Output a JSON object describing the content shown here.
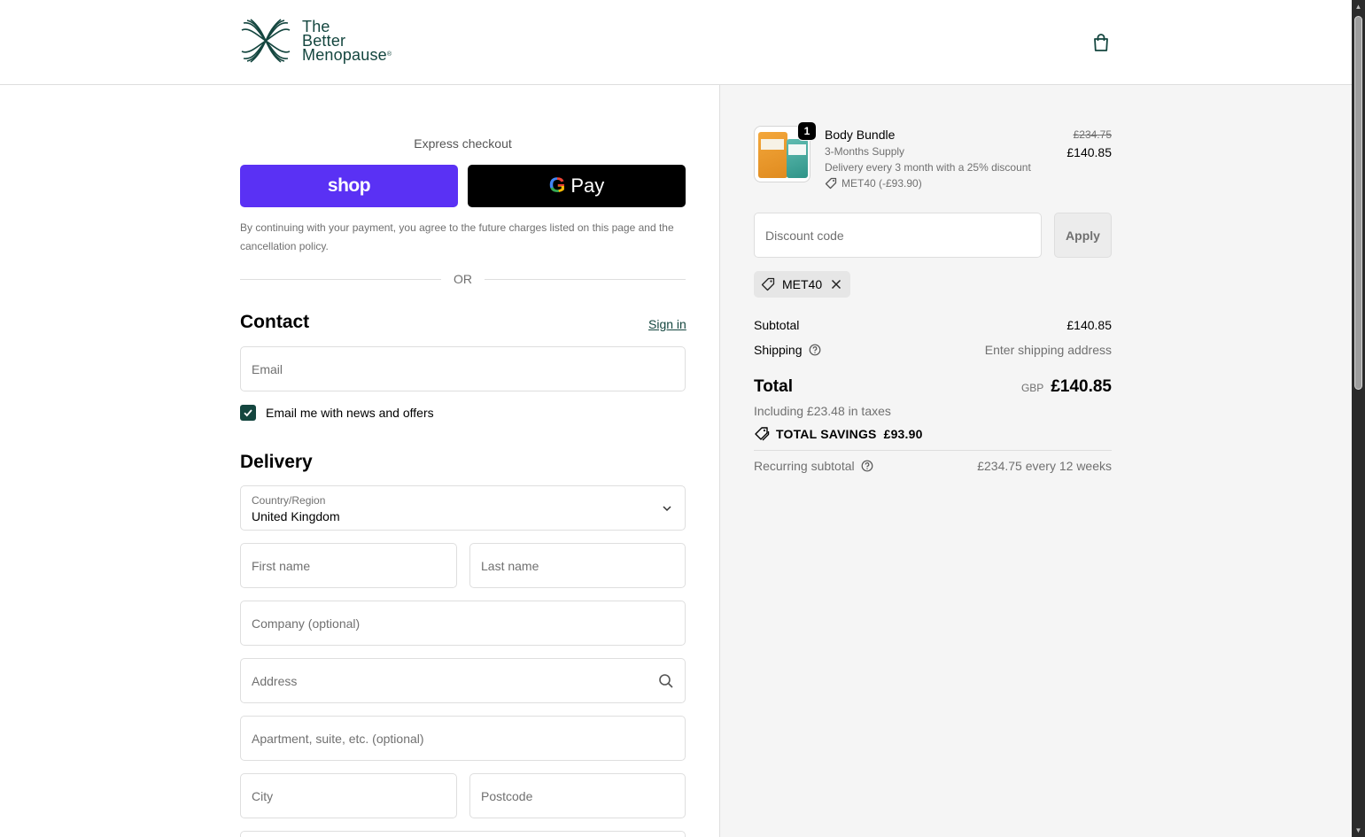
{
  "brand": {
    "line1": "The",
    "line2": "Better",
    "line3": "Menopause",
    "mark": "®"
  },
  "header": {
    "cart_icon": "shopping-bag-icon"
  },
  "express": {
    "title": "Express checkout",
    "shop_label": "shop",
    "gpay_g": "G",
    "gpay_label": "Pay",
    "consent": "By continuing with your payment, you agree to the future charges listed on this page and the cancellation policy.",
    "or": "OR"
  },
  "contact": {
    "heading": "Contact",
    "signin": "Sign in",
    "email_placeholder": "Email",
    "newsletter_label": "Email me with news and offers",
    "newsletter_checked": true
  },
  "delivery": {
    "heading": "Delivery",
    "country_label": "Country/Region",
    "country_value": "United Kingdom",
    "first_name": "First name",
    "last_name": "Last name",
    "company": "Company (optional)",
    "address": "Address",
    "apartment": "Apartment, suite, etc. (optional)",
    "city": "City",
    "postcode": "Postcode"
  },
  "summary": {
    "product": {
      "quantity": "1",
      "name": "Body Bundle",
      "variant": "3-Months Supply",
      "plan": "Delivery every 3 month with a 25% discount",
      "discount": "MET40 (-£93.90)",
      "old_price": "£234.75",
      "price": "£140.85"
    },
    "discount_placeholder": "Discount code",
    "apply_label": "Apply",
    "applied_code": "MET40",
    "subtotal_label": "Subtotal",
    "subtotal_value": "£140.85",
    "shipping_label": "Shipping",
    "shipping_value": "Enter shipping address",
    "total_label": "Total",
    "currency": "GBP",
    "total_value": "£140.85",
    "taxes": "Including £23.48 in taxes",
    "savings_label": "TOTAL SAVINGS",
    "savings_value": "£93.90",
    "recurring_label": "Recurring subtotal",
    "recurring_value": "£234.75 every 12 weeks"
  },
  "colors": {
    "brand": "#14463f",
    "shop_pay": "#5a31f4",
    "gpay": "#000000",
    "summary_bg": "#f5f5f5"
  }
}
